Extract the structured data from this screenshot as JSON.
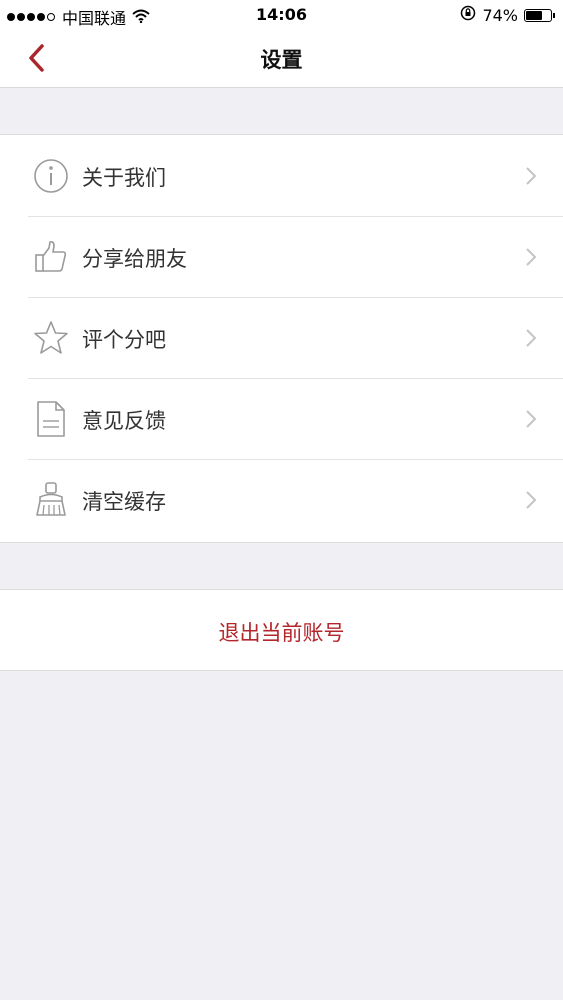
{
  "status_bar": {
    "carrier": "中国联通",
    "time": "14:06",
    "battery_percent": "74%",
    "battery_level": 0.74,
    "signal_strength": "4 of 5"
  },
  "nav": {
    "title": "设置",
    "back_icon": "chevron-left-icon",
    "accent_color": "#a8262c"
  },
  "menu": {
    "items": [
      {
        "label": "关于我们",
        "icon": "info-icon"
      },
      {
        "label": "分享给朋友",
        "icon": "thumbs-up-icon"
      },
      {
        "label": "评个分吧",
        "icon": "star-icon"
      },
      {
        "label": "意见反馈",
        "icon": "document-icon"
      },
      {
        "label": "清空缓存",
        "icon": "broom-icon"
      }
    ],
    "chevron_icon": "chevron-right-icon"
  },
  "logout": {
    "label": "退出当前账号",
    "color": "#b3262c"
  }
}
